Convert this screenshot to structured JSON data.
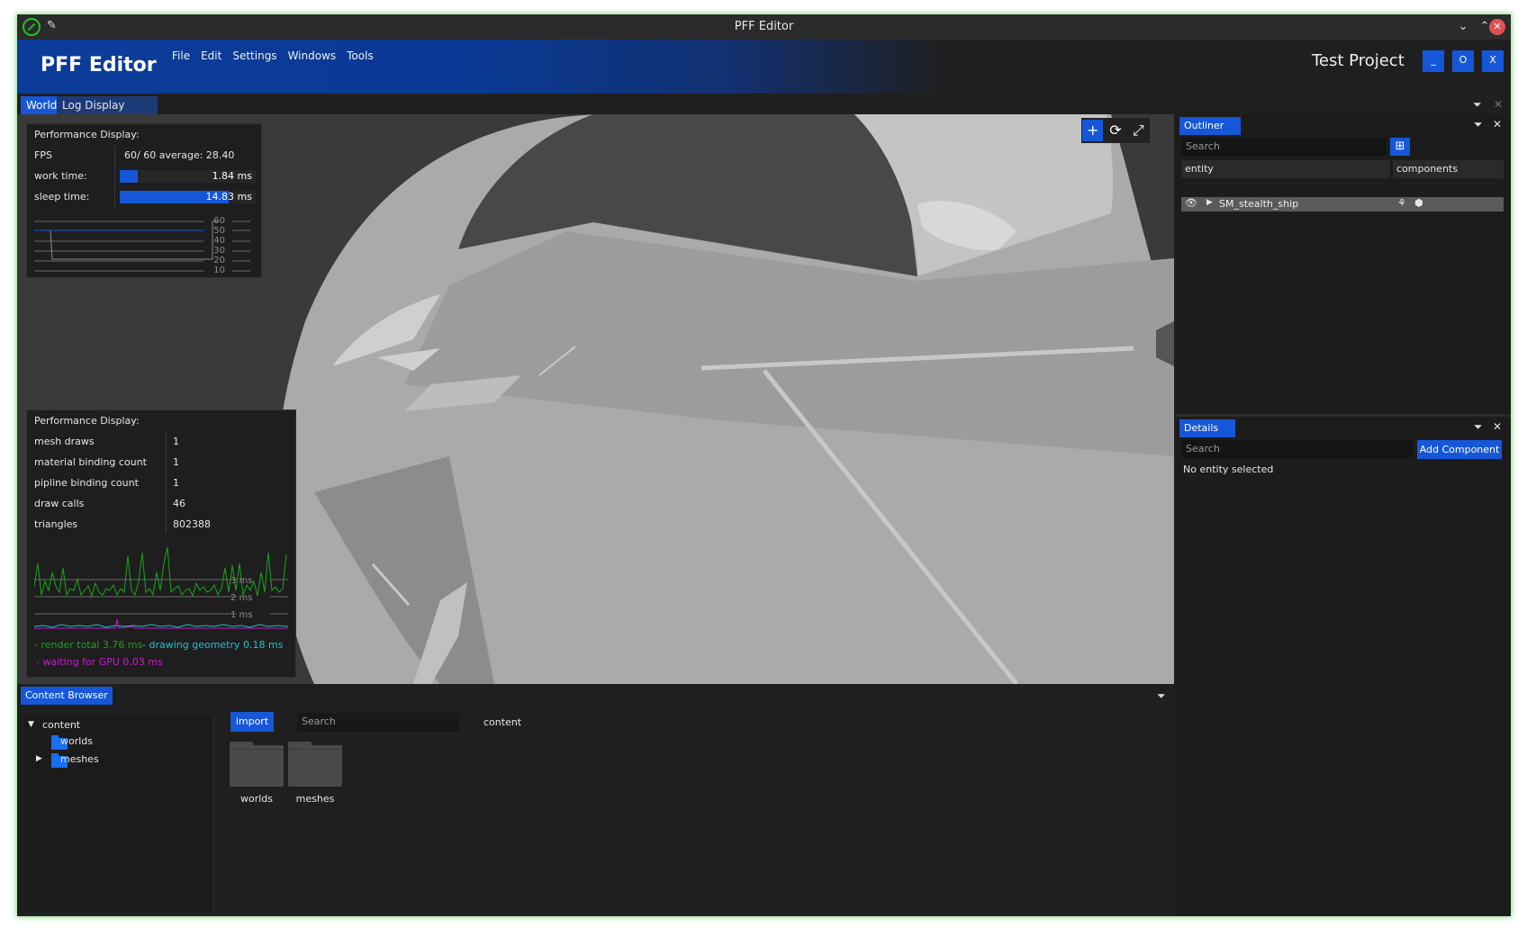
{
  "window": {
    "title": "PFF Editor"
  },
  "header": {
    "brand": "PFF Editor",
    "menu": [
      "File",
      "Edit",
      "Settings",
      "Windows",
      "Tools"
    ],
    "project_name": "Test Project",
    "buttons": {
      "minimize": "_",
      "maximize": "O",
      "close": "X"
    }
  },
  "tabs": [
    {
      "label": "World",
      "active": true
    },
    {
      "label": "Log Display",
      "active": false
    }
  ],
  "perf_top": {
    "heading": "Performance Display:",
    "fps_label": "FPS",
    "fps_value": "60/  60  average: 28.40",
    "work_label": "work time:",
    "work_value": "1.84 ms",
    "work_fraction": 0.13,
    "sleep_label": "sleep time:",
    "sleep_value": "14.83 ms",
    "sleep_fraction": 1.0,
    "graph_ticks": [
      "60",
      "50",
      "40",
      "30",
      "20",
      "10"
    ]
  },
  "perf_bottom": {
    "heading": "Performance Display:",
    "rows": [
      {
        "label": "mesh draws",
        "value": "1"
      },
      {
        "label": "material binding count",
        "value": "1"
      },
      {
        "label": "pipline binding count",
        "value": "1"
      },
      {
        "label": "draw calls",
        "value": "46"
      },
      {
        "label": "triangles",
        "value": "802388"
      }
    ],
    "graph_ticks": [
      "3 ms",
      "2 ms",
      "1 ms"
    ],
    "legend": {
      "render": "- render total  3.76 ms",
      "drawing": "- drawing geometry  0.18 ms",
      "waiting": "- waiting for GPU  0.03 ms"
    },
    "colors": {
      "render": "#1aa51a",
      "drawing": "#22bfd6",
      "waiting": "#c61ec6"
    }
  },
  "outliner": {
    "title": "Outliner",
    "search_placeholder": "Search",
    "col_entity": "entity",
    "col_components": "components",
    "entities": [
      {
        "name": "SM_stealth_ship"
      }
    ]
  },
  "details": {
    "title": "Details",
    "search_placeholder": "Search",
    "add_component": "Add Component",
    "empty_text": "No entity selected"
  },
  "content_browser": {
    "title": "Content Browser",
    "tree": [
      {
        "label": "content"
      },
      {
        "label": "worlds"
      },
      {
        "label": "meshes"
      }
    ],
    "import_label": "import",
    "search_placeholder": "Search",
    "path": "content",
    "folders": [
      {
        "label": "worlds"
      },
      {
        "label": "meshes"
      }
    ]
  },
  "colors": {
    "accent": "#1557d8",
    "header_blue": "#0c3c9a",
    "background": "#1f1f1f"
  }
}
